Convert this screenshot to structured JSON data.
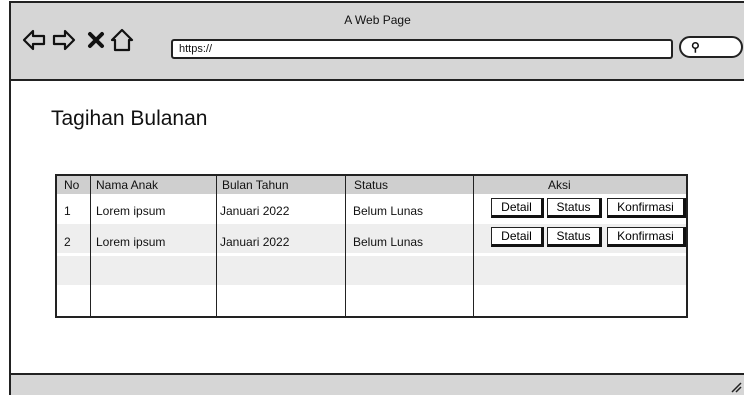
{
  "window": {
    "title": "A Web Page"
  },
  "browser": {
    "url": "https://",
    "nav_icons": [
      "back-arrow-icon",
      "forward-arrow-icon",
      "close-icon",
      "home-icon"
    ],
    "search_icon": "magnifier-icon"
  },
  "page": {
    "heading": "Tagihan Bulanan"
  },
  "table": {
    "headers": {
      "no": "No",
      "name": "Nama Anak",
      "month": "Bulan Tahun",
      "status": "Status",
      "action": "Aksi"
    },
    "rows": [
      {
        "no": "1",
        "name": "Lorem ipsum",
        "month": "Januari 2022",
        "status": "Belum Lunas"
      },
      {
        "no": "2",
        "name": "Lorem ipsum",
        "month": "Januari 2022",
        "status": "Belum Lunas"
      }
    ],
    "actions": {
      "detail": "Detail",
      "status": "Status",
      "confirm": "Konfirmasi"
    }
  }
}
